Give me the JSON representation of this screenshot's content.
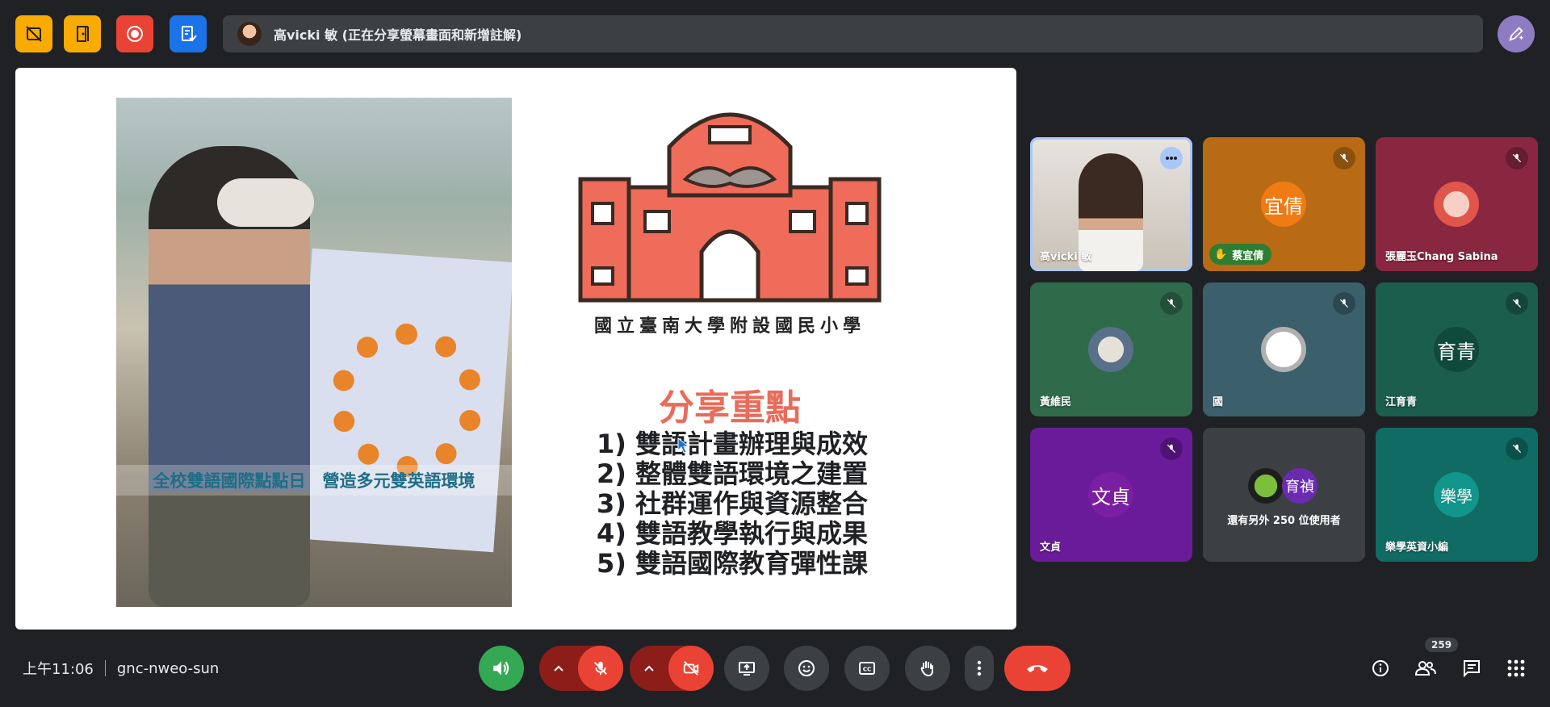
{
  "topbar": {
    "presenter_banner": "高vicki 敏 (正在分享螢幕畫面和新增註解)",
    "buttons": [
      "video-off-icon",
      "door-icon",
      "record-icon",
      "form-icon"
    ],
    "colors": {
      "yellow": "#f9ab00",
      "red": "#ea4335",
      "blue": "#1a73e8",
      "pen": "#8e7cc3"
    }
  },
  "slide": {
    "photo_caption": "全校雙語國際點點日　營造多元雙英語環境",
    "school_name": "國立臺南大學附設國民小學",
    "share_title": "分享重點",
    "points": [
      "1) 雙語計畫辦理與成效",
      "2) 整體雙語環境之建置",
      "3) 社群運作與資源整合",
      "4) 雙語教學執行與成果",
      "5) 雙語國際教育彈性課"
    ]
  },
  "participants": [
    {
      "name": "高vicki 敏",
      "type": "video",
      "bg": "#d8d3cc"
    },
    {
      "name": "",
      "pill": "蔡宜倩",
      "initials": "宜倩",
      "bg": "#b86b14",
      "avatar_color": "#f07a14"
    },
    {
      "name": "張麗玉Chang Sabina",
      "type": "photo",
      "bg": "#8a2740"
    },
    {
      "name": "黃維民",
      "type": "photo",
      "bg": "#2f6a4b"
    },
    {
      "name": "國",
      "type": "photo",
      "bg": "#3b5f6b"
    },
    {
      "name": "江育青",
      "initials": "育青",
      "bg": "#1b5e4e",
      "avatar_color": "#0f4a3c"
    },
    {
      "name": "文貞",
      "initials": "文貞",
      "bg": "#6a1b9a",
      "avatar_color": "#7b1fa2"
    },
    {
      "name": "還有另外 250 位使用者",
      "initials": "育禎",
      "bg": "#3c4043",
      "avatar_color": "#6a2bb0"
    },
    {
      "name": "樂學英資小編",
      "initials": "樂學",
      "bg": "#0f6b63",
      "avatar_color": "#12958a"
    }
  ],
  "bottom": {
    "time": "上午11:06",
    "meeting_code": "gnc-nweo-sun",
    "participant_count": "259"
  }
}
